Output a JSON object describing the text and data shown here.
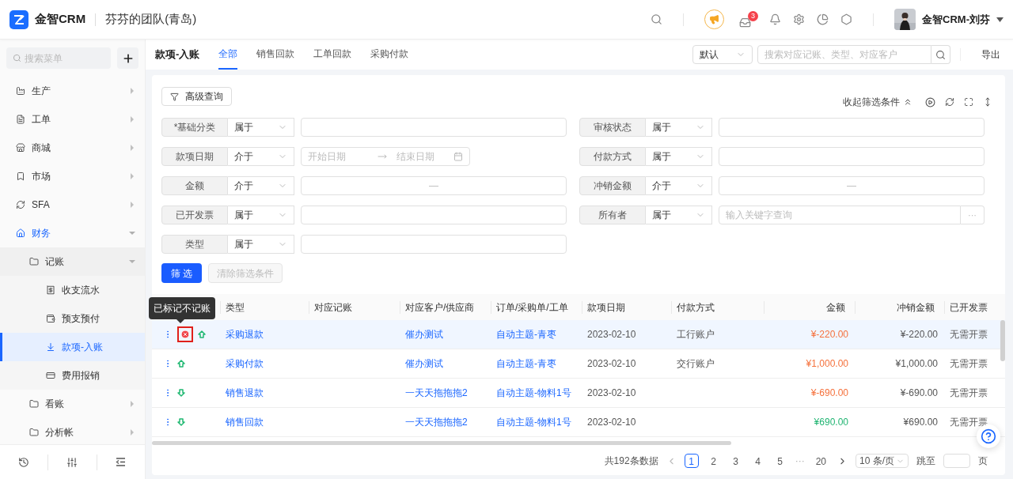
{
  "header": {
    "brand": "金智CRM",
    "team": "芬芬的团队(青岛)",
    "notification_count": "3",
    "user": "金智CRM-刘芬"
  },
  "sidebar": {
    "search_placeholder": "搜索菜单",
    "items": [
      {
        "label": "生产",
        "expanded": false,
        "selected": false
      },
      {
        "label": "工单",
        "expanded": false,
        "selected": false
      },
      {
        "label": "商城",
        "expanded": false,
        "selected": false
      },
      {
        "label": "市场",
        "expanded": false,
        "selected": false
      },
      {
        "label": "SFA",
        "expanded": false,
        "selected": false
      },
      {
        "label": "财务",
        "expanded": true,
        "selected": false,
        "children": [
          {
            "label": "记账",
            "expanded": true,
            "selected": false,
            "children": [
              {
                "label": "收支流水",
                "selected": false
              },
              {
                "label": "预支预付",
                "selected": false
              },
              {
                "label": "款项-入账",
                "selected": true
              },
              {
                "label": "费用报销",
                "selected": false
              }
            ]
          },
          {
            "label": "看账",
            "expanded": false,
            "selected": false
          },
          {
            "label": "分析帐",
            "expanded": false,
            "selected": false
          }
        ]
      }
    ]
  },
  "page": {
    "title": "款项-入账",
    "tabs": [
      {
        "label": "全部",
        "selected": true
      },
      {
        "label": "销售回款",
        "selected": false
      },
      {
        "label": "工单回款",
        "selected": false
      },
      {
        "label": "采购付款",
        "selected": false
      }
    ],
    "view_select": "默认",
    "search_placeholder": "搜索对应记账、类型、对应客户",
    "export": "导出"
  },
  "filters": {
    "advanced": "高级查询",
    "collapse": "收起筛选条件",
    "left": [
      {
        "label": "*基础分类",
        "operator": "属于",
        "kind": "text"
      },
      {
        "label": "款项日期",
        "operator": "介于",
        "kind": "date_range",
        "start_placeholder": "开始日期",
        "end_placeholder": "结束日期"
      },
      {
        "label": "金额",
        "operator": "介于",
        "kind": "range",
        "separator": "—"
      },
      {
        "label": "已开发票",
        "operator": "属于",
        "kind": "text"
      },
      {
        "label": "类型",
        "operator": "属于",
        "kind": "text"
      }
    ],
    "right": [
      {
        "label": "审核状态",
        "operator": "属于",
        "kind": "text"
      },
      {
        "label": "付款方式",
        "operator": "属于",
        "kind": "text"
      },
      {
        "label": "冲销金额",
        "operator": "介于",
        "kind": "range",
        "separator": "—"
      },
      {
        "label": "所有者",
        "operator": "属于",
        "kind": "lookup",
        "placeholder": "输入关键字查询",
        "more": "···"
      }
    ],
    "apply": "筛 选",
    "clear": {
      "label": "清除筛选条件",
      "disabled": true
    }
  },
  "table": {
    "tooltip": "已标记不记账",
    "columns": [
      "类型",
      "对应记账",
      "对应客户/供应商",
      "订单/采购单/工单",
      "款项日期",
      "付款方式",
      "金额",
      "冲销金额",
      "已开发票"
    ],
    "rows": [
      {
        "selected": true,
        "excluded": true,
        "kind": "up",
        "type": "采购退款",
        "customer": "催办测试",
        "order": "自动主题-青枣",
        "date": "2023-02-10",
        "method": "工行账户",
        "amount": "¥-220.00",
        "color": "#f5713c",
        "offset": "¥-220.00",
        "invoice": "无需开票"
      },
      {
        "selected": false,
        "excluded": false,
        "kind": "up",
        "type": "采购付款",
        "customer": "催办测试",
        "order": "自动主题-青枣",
        "date": "2023-02-10",
        "method": "交行账户",
        "amount": "¥1,000.00",
        "color": "#f5713c",
        "offset": "¥1,000.00",
        "invoice": "无需开票"
      },
      {
        "selected": false,
        "excluded": false,
        "kind": "down",
        "type": "销售退款",
        "customer": "一天天拖拖拖2",
        "order": "自动主题-物料1号",
        "date": "2023-02-10",
        "amount": "¥-690.00",
        "color": "#f5713c",
        "offset": "¥-690.00",
        "invoice": "无需开票"
      },
      {
        "selected": false,
        "excluded": false,
        "kind": "down",
        "type": "销售回款",
        "customer": "一天天拖拖拖2",
        "order": "自动主题-物料1号",
        "date": "2023-02-10",
        "amount": "¥690.00",
        "color": "#22b573",
        "offset": "¥690.00",
        "invoice": "无需开票"
      }
    ]
  },
  "pagination": {
    "total": "共192条数据",
    "pages": [
      {
        "kind": "page",
        "label": "1",
        "selected": true
      },
      {
        "kind": "page",
        "label": "2",
        "selected": false
      },
      {
        "kind": "page",
        "label": "3",
        "selected": false
      },
      {
        "kind": "page",
        "label": "4",
        "selected": false
      },
      {
        "kind": "page",
        "label": "5",
        "selected": false
      },
      {
        "kind": "ellipsis",
        "label": "···"
      },
      {
        "kind": "page",
        "label": "20",
        "selected": false
      }
    ],
    "page_size": "10 条/页",
    "jump": "跳至",
    "unit": "页"
  }
}
